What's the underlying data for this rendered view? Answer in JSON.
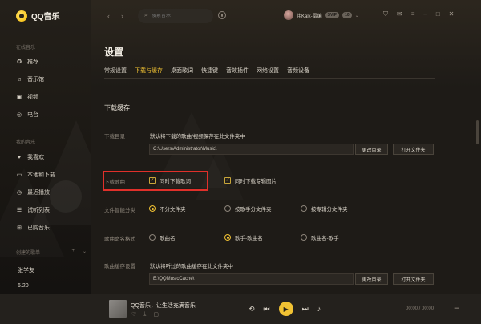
{
  "app": {
    "name": "QQ音乐"
  },
  "sidebar": {
    "online_title": "在线音乐",
    "online_items": [
      {
        "label": "推荐",
        "icon": "star-icon"
      },
      {
        "label": "音乐馆",
        "icon": "music-note-icon"
      },
      {
        "label": "视频",
        "icon": "video-icon"
      },
      {
        "label": "电台",
        "icon": "radio-icon"
      }
    ],
    "mine_title": "我的音乐",
    "mine_items": [
      {
        "label": "我喜欢",
        "icon": "heart-icon"
      },
      {
        "label": "本地和下载",
        "icon": "computer-icon"
      },
      {
        "label": "最近播放",
        "icon": "clock-icon"
      },
      {
        "label": "试听列表",
        "icon": "list-icon"
      },
      {
        "label": "已购音乐",
        "icon": "bag-icon"
      }
    ],
    "create_title": "创建的歌单",
    "create_add": "+",
    "create_collapse": "⌄",
    "playlists": [
      "张学友",
      "6.20",
      "纯音乐",
      "3.19"
    ]
  },
  "topbar": {
    "back": "‹",
    "forward": "›",
    "search_placeholder": "搜索音乐",
    "user_name": "伟Kalk-雷编",
    "badges": [
      "SVIP",
      "10"
    ],
    "window_icons": [
      "shirt-icon",
      "mail-icon",
      "settings-icon",
      "minimize-icon",
      "maximize-icon",
      "close-icon"
    ]
  },
  "settings": {
    "title": "设置",
    "tabs": [
      {
        "label": "常规设置",
        "active": false
      },
      {
        "label": "下载与缓存",
        "active": true
      },
      {
        "label": "桌面歌词",
        "active": false
      },
      {
        "label": "快捷键",
        "active": false
      },
      {
        "label": "音效插件",
        "active": false
      },
      {
        "label": "网络设置",
        "active": false
      },
      {
        "label": "音频设备",
        "active": false
      }
    ],
    "section_title": "下载缓存",
    "download_dir": {
      "label": "下载目录",
      "desc": "默认将下载的歌曲/视频保存在此文件夹中",
      "path": "C:\\Users\\Administrator\\Music\\",
      "change_btn": "更改目录",
      "open_btn": "打开文件夹"
    },
    "download_songs": {
      "label": "下载歌曲",
      "lyrics_label": "同时下载歌词",
      "lyrics_checked": true,
      "cover_label": "同时下载专辑图片",
      "cover_checked": true
    },
    "file_category": {
      "label": "文件智能分类",
      "options": [
        "不分文件夹",
        "按歌手分文件夹",
        "按专辑分文件夹"
      ],
      "selected": 0
    },
    "song_naming": {
      "label": "歌曲命名格式",
      "options": [
        "歌曲名",
        "歌手-歌曲名",
        "歌曲名-歌手"
      ],
      "selected": 1
    },
    "cache_dir": {
      "label": "歌曲缓存设置",
      "desc": "默认将听过的歌曲缓存在此文件夹中",
      "path": "E:\\QQMusicCache\\",
      "change_btn": "更改目录",
      "open_btn": "打开文件夹"
    }
  },
  "player": {
    "song_title": "QQ音乐，让生活充满音乐",
    "time": "00:00 / 00:00",
    "accent": "#f1c233"
  }
}
